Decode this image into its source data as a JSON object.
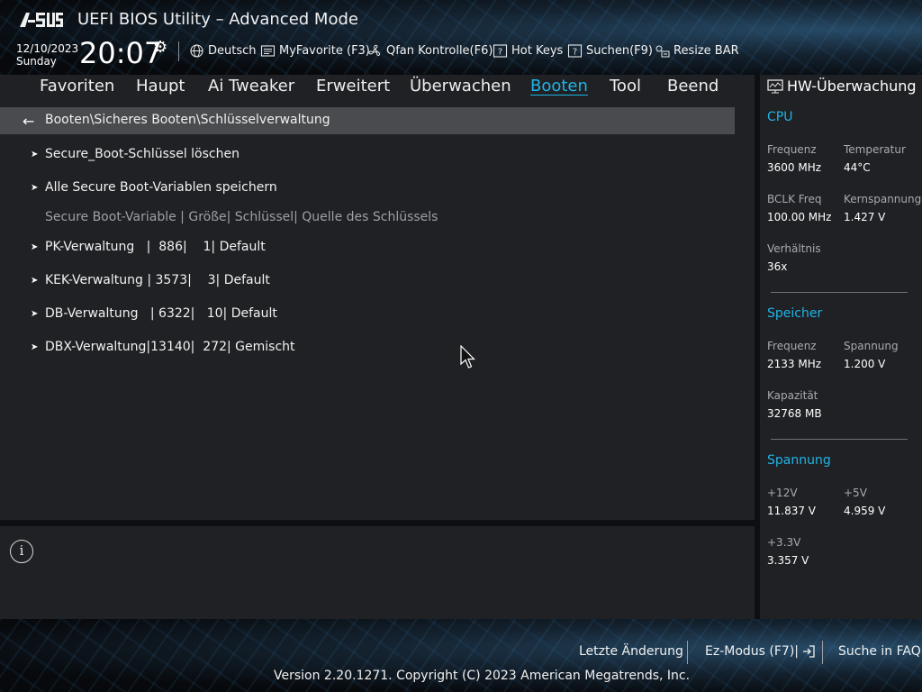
{
  "app": {
    "brand": "ASUS",
    "title": "UEFI BIOS Utility – Advanced Mode"
  },
  "datetime": {
    "date": "12/10/2023",
    "weekday": "Sunday",
    "time": "20:07"
  },
  "toolbar": {
    "language": "Deutsch",
    "myfavorite": "MyFavorite (F3)",
    "qfan": "Qfan Kontrolle(F6)",
    "hotkeys": "Hot Keys",
    "search": "Suchen(F9)",
    "resizebar": "Resize BAR"
  },
  "menu": {
    "items": [
      "Favoriten",
      "Haupt",
      "Ai Tweaker",
      "Erweitert",
      "Überwachen",
      "Booten",
      "Tool",
      "Beend"
    ],
    "active": "Booten"
  },
  "breadcrumb": "Booten\\Sicheres Booten\\Schlüsselverwaltung",
  "content": {
    "items": [
      "Secure_Boot-Schlüssel löschen",
      "Alle Secure Boot-Variablen speichern"
    ],
    "table_header": "Secure Boot-Variable | Größe| Schlüssel| Quelle des Schlüssels",
    "table_rows": [
      "PK-Verwaltung   |  886|    1| Default",
      "KEK-Verwaltung | 3573|    3| Default",
      "DB-Verwaltung   | 6322|   10| Default",
      "DBX-Verwaltung|13140|  272| Gemischt"
    ]
  },
  "hw": {
    "title": "HW-Überwachung",
    "cpu": {
      "heading": "CPU",
      "freq_label": "Frequenz",
      "freq": "3600 MHz",
      "temp_label": "Temperatur",
      "temp": "44°C",
      "bclk_label": "BCLK Freq",
      "bclk": "100.00 MHz",
      "vcore_label": "Kernspannung",
      "vcore": "1.427 V",
      "ratio_label": "Verhältnis",
      "ratio": "36x"
    },
    "memory": {
      "heading": "Speicher",
      "freq_label": "Frequenz",
      "freq": "2133 MHz",
      "volt_label": "Spannung",
      "volt": "1.200 V",
      "cap_label": "Kapazität",
      "cap": "32768 MB"
    },
    "voltage": {
      "heading": "Spannung",
      "v12_label": "+12V",
      "v12": "11.837 V",
      "v5_label": "+5V",
      "v5": "4.959 V",
      "v33_label": "+3.3V",
      "v33": "3.357 V"
    }
  },
  "footer": {
    "last_change": "Letzte Änderung",
    "ez_mode": "Ez-Modus (F7)|",
    "faq": "Suche in FAQ",
    "copyright": "Version 2.20.1271. Copyright (C) 2023 American Megatrends, Inc."
  },
  "colors": {
    "accent": "#1fb4e8",
    "panel": "#202124",
    "highlight": "#4a4b4e"
  }
}
